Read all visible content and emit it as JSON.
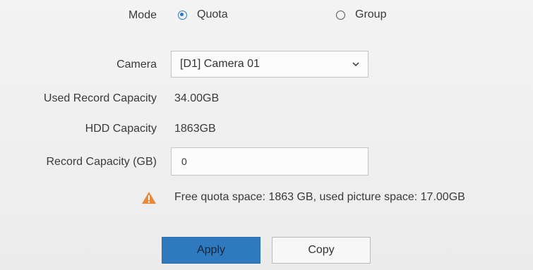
{
  "mode": {
    "label": "Mode",
    "options": [
      {
        "label": "Quota",
        "checked": true
      },
      {
        "label": "Group",
        "checked": false
      }
    ]
  },
  "camera": {
    "label": "Camera",
    "selected": "[D1] Camera 01"
  },
  "used_record_capacity": {
    "label": "Used Record Capacity",
    "value": "34.00GB"
  },
  "hdd_capacity": {
    "label": "HDD Capacity",
    "value": "1863GB"
  },
  "record_capacity": {
    "label": "Record Capacity (GB)",
    "value": "0"
  },
  "warning": {
    "icon": "warning-triangle-icon",
    "text": "Free quota space: 1863 GB, used picture space: 17.00GB",
    "color": "#e8883a"
  },
  "buttons": {
    "apply": "Apply",
    "copy": "Copy"
  },
  "colors": {
    "accent": "#2f79bf"
  }
}
